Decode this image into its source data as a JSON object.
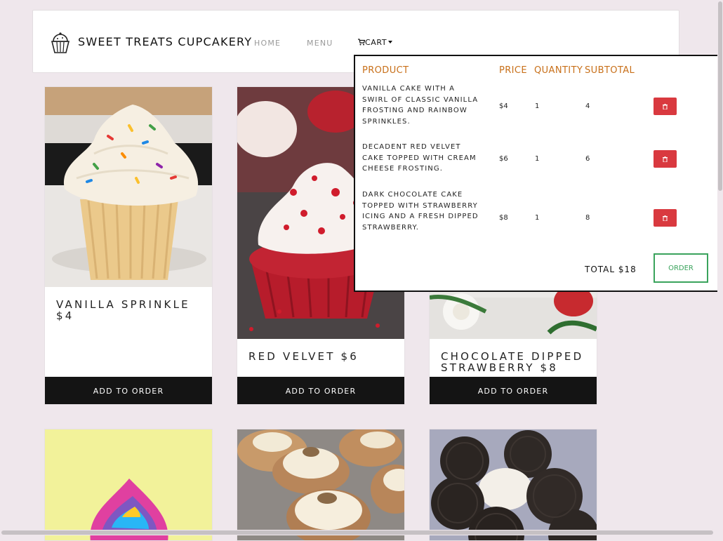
{
  "brand": {
    "name": "SWEET TREATS CUPCAKERY",
    "logo": "cupcake-icon"
  },
  "nav": {
    "home": "HOME",
    "menu": "MENU",
    "cart": "CART"
  },
  "products": [
    {
      "title": "VANILLA SPRINKLE $4",
      "button": "ADD TO ORDER"
    },
    {
      "title": "RED VELVET $6",
      "button": "ADD TO ORDER"
    },
    {
      "title": "CHOCOLATE DIPPED STRAWBERRY $8",
      "button": "ADD TO ORDER"
    }
  ],
  "cart": {
    "headers": {
      "product": "PRODUCT",
      "price": "PRICE",
      "quantity": "QUANTITY",
      "subtotal": "SUBTOTAL"
    },
    "items": [
      {
        "desc": "VANILLA CAKE WITH A SWIRL OF CLASSIC VANILLA FROSTING AND RAINBOW SPRINKLES.",
        "price": "$4",
        "qty": "1",
        "subtotal": "4"
      },
      {
        "desc": "DECADENT RED VELVET CAKE TOPPED WITH CREAM CHEESE FROSTING.",
        "price": "$6",
        "qty": "1",
        "subtotal": "6"
      },
      {
        "desc": "DARK CHOCOLATE CAKE TOPPED WITH STRAWBERRY ICING AND A FRESH DIPPED STRAWBERRY.",
        "price": "$8",
        "qty": "1",
        "subtotal": "8"
      }
    ],
    "total": "TOTAL $18",
    "order_button": "ORDER"
  },
  "colors": {
    "accent": "#c8701a",
    "delete": "#d9393f",
    "order": "#3aa35c",
    "background": "#efe7ec"
  }
}
